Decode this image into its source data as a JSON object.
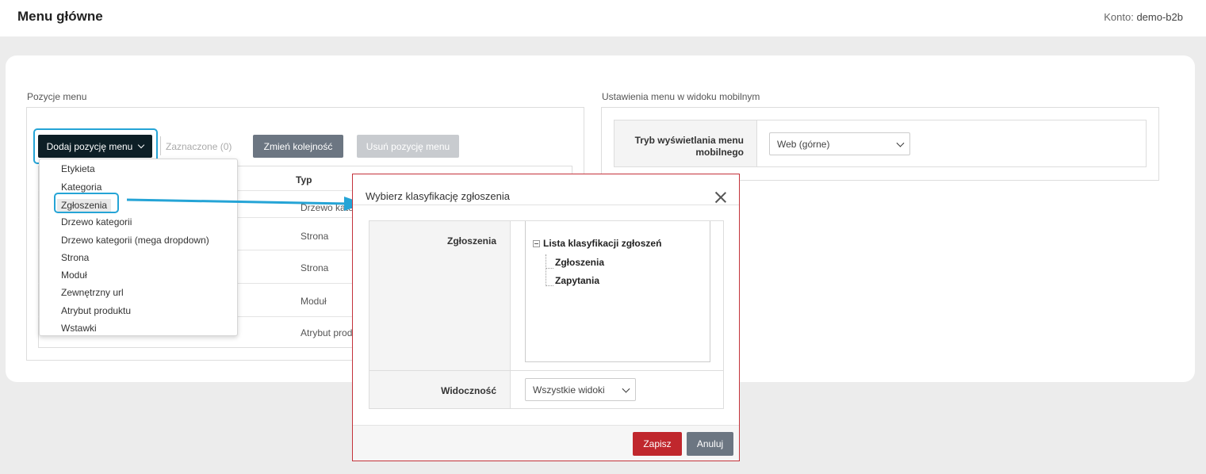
{
  "header": {
    "title": "Menu główne",
    "account_label": "Konto:",
    "account_value": "demo-b2b"
  },
  "menu_positions": {
    "section_label": "Pozycje menu",
    "add_button": "Dodaj pozycję menu",
    "selected_count": "Zaznaczone (0)",
    "reorder_button": "Zmień kolejność",
    "delete_button": "Usuń pozycję menu",
    "table_header_type": "Typ",
    "rows": [
      "Drzewo kategorii",
      "Strona",
      "Strona",
      "Moduł",
      "Atrybut produktu"
    ]
  },
  "dropdown": {
    "items": [
      "Etykieta",
      "Kategoria",
      "Zgłoszenia",
      "Drzewo kategorii",
      "Drzewo kategorii (mega dropdown)",
      "Strona",
      "Moduł",
      "Zewnętrzny url",
      "Atrybut produktu",
      "Wstawki"
    ],
    "highlighted": "Zgłoszenia"
  },
  "mobile": {
    "section_label": "Ustawienia menu w widoku mobilnym",
    "mode_label": "Tryb wyświetlania menu mobilnego",
    "mode_value": "Web (górne)"
  },
  "modal": {
    "title": "Wybierz klasyfikację zgłoszenia",
    "field1_label": "Zgłoszenia",
    "tree_root": "Lista klasyfikacji zgłoszeń",
    "tree_children": [
      "Zgłoszenia",
      "Zapytania"
    ],
    "field2_label": "Widoczność",
    "visibility_value": "Wszystkie widoki",
    "save_button": "Zapisz",
    "cancel_button": "Anuluj"
  },
  "colors": {
    "accent_highlight": "#25a4d6",
    "primary_dark": "#0d1f26",
    "danger": "#c0272d",
    "neutral_button": "#6c7682"
  }
}
